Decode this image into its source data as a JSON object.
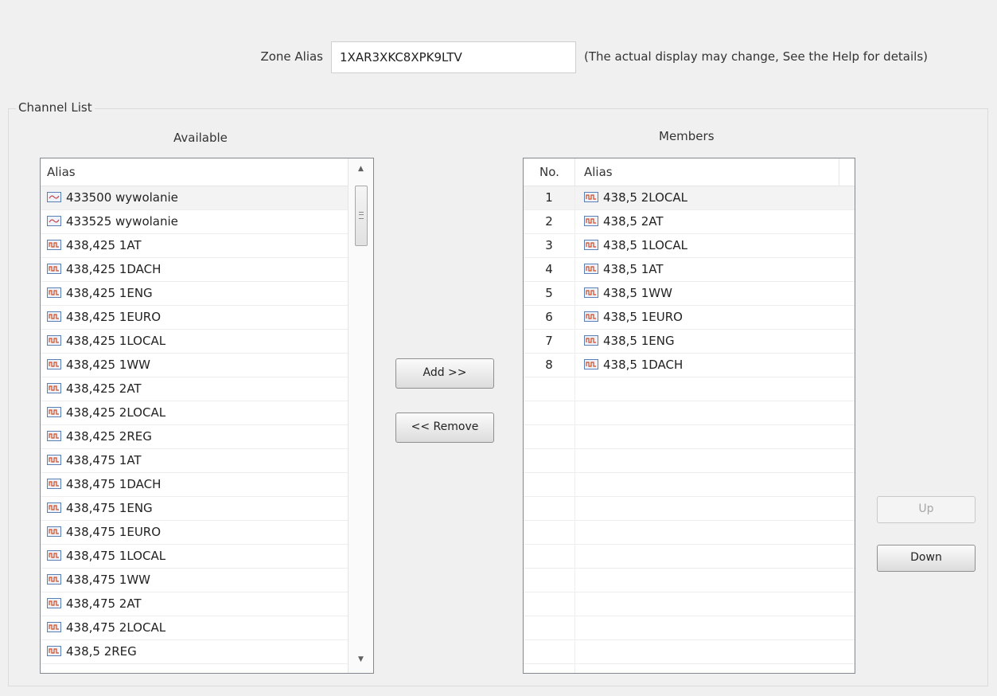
{
  "zone": {
    "label": "Zone Alias",
    "value": "1XAR3XKC8XPK9LTV",
    "note": "(The actual display may change, See the Help for details)"
  },
  "channel_list": {
    "title": "Channel List",
    "available": {
      "title": "Available",
      "header": "Alias",
      "items": [
        {
          "label": "433500 wywolanie",
          "icon": "analog-channel-icon"
        },
        {
          "label": "433525 wywolanie",
          "icon": "analog-channel-icon"
        },
        {
          "label": "438,425 1AT",
          "icon": "digital-channel-icon"
        },
        {
          "label": "438,425 1DACH",
          "icon": "digital-channel-icon"
        },
        {
          "label": "438,425 1ENG",
          "icon": "digital-channel-icon"
        },
        {
          "label": "438,425 1EURO",
          "icon": "digital-channel-icon"
        },
        {
          "label": "438,425 1LOCAL",
          "icon": "digital-channel-icon"
        },
        {
          "label": "438,425 1WW",
          "icon": "digital-channel-icon"
        },
        {
          "label": "438,425 2AT",
          "icon": "digital-channel-icon"
        },
        {
          "label": "438,425 2LOCAL",
          "icon": "digital-channel-icon"
        },
        {
          "label": "438,425 2REG",
          "icon": "digital-channel-icon"
        },
        {
          "label": "438,475 1AT",
          "icon": "digital-channel-icon"
        },
        {
          "label": "438,475 1DACH",
          "icon": "digital-channel-icon"
        },
        {
          "label": "438,475 1ENG",
          "icon": "digital-channel-icon"
        },
        {
          "label": "438,475 1EURO",
          "icon": "digital-channel-icon"
        },
        {
          "label": "438,475 1LOCAL",
          "icon": "digital-channel-icon"
        },
        {
          "label": "438,475 1WW",
          "icon": "digital-channel-icon"
        },
        {
          "label": "438,475 2AT",
          "icon": "digital-channel-icon"
        },
        {
          "label": "438,475 2LOCAL",
          "icon": "digital-channel-icon"
        },
        {
          "label": "438,5 2REG",
          "icon": "digital-channel-icon"
        }
      ]
    },
    "members": {
      "title": "Members",
      "header_no": "No.",
      "header_alias": "Alias",
      "items": [
        {
          "no": "1",
          "label": "438,5 2LOCAL",
          "icon": "digital-channel-icon"
        },
        {
          "no": "2",
          "label": "438,5 2AT",
          "icon": "digital-channel-icon"
        },
        {
          "no": "3",
          "label": "438,5 1LOCAL",
          "icon": "digital-channel-icon"
        },
        {
          "no": "4",
          "label": "438,5 1AT",
          "icon": "digital-channel-icon"
        },
        {
          "no": "5",
          "label": "438,5 1WW",
          "icon": "digital-channel-icon"
        },
        {
          "no": "6",
          "label": "438,5 1EURO",
          "icon": "digital-channel-icon"
        },
        {
          "no": "7",
          "label": "438,5 1ENG",
          "icon": "digital-channel-icon"
        },
        {
          "no": "8",
          "label": "438,5 1DACH",
          "icon": "digital-channel-icon"
        }
      ]
    },
    "buttons": {
      "add": "Add >>",
      "remove": "<< Remove",
      "up": "Up",
      "down": "Down"
    }
  },
  "colors": {
    "window_bg": "#f0f0f0",
    "icon_border": "#5a7fb5",
    "analog_wave": "#c85050",
    "digital_wave": "#d04a20",
    "disabled_text": "#a6a6a6"
  }
}
